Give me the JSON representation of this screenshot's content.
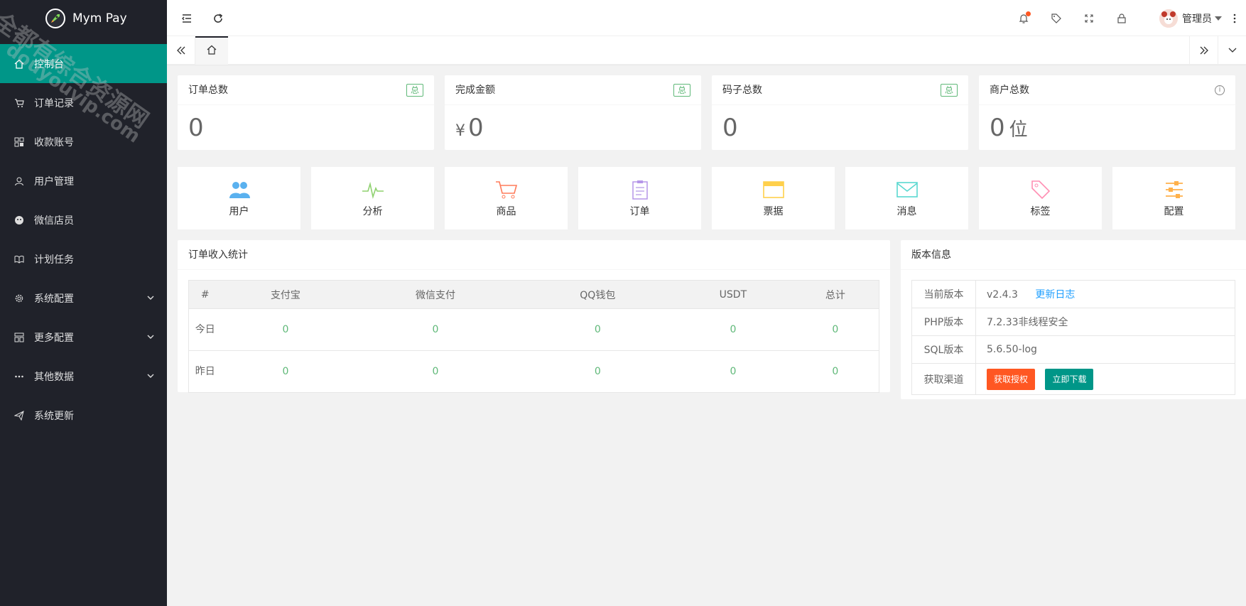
{
  "app": {
    "name": "Mym Pay"
  },
  "watermark": {
    "line1": "全都有综合资源网",
    "line2": "douyouvip.com"
  },
  "sidebar": {
    "items": [
      {
        "label": "控制台",
        "icon": "home-icon",
        "active": true
      },
      {
        "label": "订单记录",
        "icon": "cart-icon"
      },
      {
        "label": "收款账号",
        "icon": "apps-icon"
      },
      {
        "label": "用户管理",
        "icon": "user-icon"
      },
      {
        "label": "微信店员",
        "icon": "wechat-icon"
      },
      {
        "label": "计划任务",
        "icon": "read-icon"
      },
      {
        "label": "系统配置",
        "icon": "gear-icon",
        "expandable": true
      },
      {
        "label": "更多配置",
        "icon": "template-icon",
        "expandable": true
      },
      {
        "label": "其他数据",
        "icon": "more-icon",
        "expandable": true
      },
      {
        "label": "系统更新",
        "icon": "release-icon"
      }
    ]
  },
  "header": {
    "admin_label": "管理员"
  },
  "stats": [
    {
      "title": "订单总数",
      "badge": "总",
      "value": "0"
    },
    {
      "title": "完成金额",
      "badge": "总",
      "prefix": "¥",
      "value": "0"
    },
    {
      "title": "码子总数",
      "badge": "总",
      "value": "0"
    },
    {
      "title": "商户总数",
      "value": "0",
      "unit": "位"
    }
  ],
  "quick_links": [
    {
      "label": "用户",
      "icon": "users-icon",
      "color": "#5ab1ef"
    },
    {
      "label": "分析",
      "icon": "pulse-icon",
      "color": "#8fd16f"
    },
    {
      "label": "商品",
      "icon": "cart-icon",
      "color": "#ff7b5a"
    },
    {
      "label": "订单",
      "icon": "clipboard-icon",
      "color": "#b596e8"
    },
    {
      "label": "票据",
      "icon": "ticket-icon",
      "color": "#ffd04b"
    },
    {
      "label": "消息",
      "icon": "mail-icon",
      "color": "#5ad8d0"
    },
    {
      "label": "标签",
      "icon": "tag-icon",
      "color": "#ff8fb3"
    },
    {
      "label": "配置",
      "icon": "sliders-icon",
      "color": "#ffb14b"
    }
  ],
  "income": {
    "title": "订单收入统计",
    "columns": [
      "#",
      "支付宝",
      "微信支付",
      "QQ钱包",
      "USDT",
      "总计"
    ],
    "rows": [
      {
        "label": "今日",
        "values": [
          "0",
          "0",
          "0",
          "0",
          "0"
        ]
      },
      {
        "label": "昨日",
        "values": [
          "0",
          "0",
          "0",
          "0",
          "0"
        ]
      }
    ]
  },
  "version": {
    "title": "版本信息",
    "rows": [
      {
        "key": "当前版本",
        "value": "v2.4.3",
        "link": "更新日志"
      },
      {
        "key": "PHP版本",
        "value": "7.2.33非线程安全"
      },
      {
        "key": "SQL版本",
        "value": "5.6.50-log"
      },
      {
        "key": "获取渠道",
        "btn1": "获取授权",
        "btn2": "立即下载"
      }
    ]
  },
  "colors": {
    "sidebar_bg": "#20222a",
    "accent": "#009688",
    "green_text": "#5fb878",
    "orange_btn": "#ff5722"
  }
}
